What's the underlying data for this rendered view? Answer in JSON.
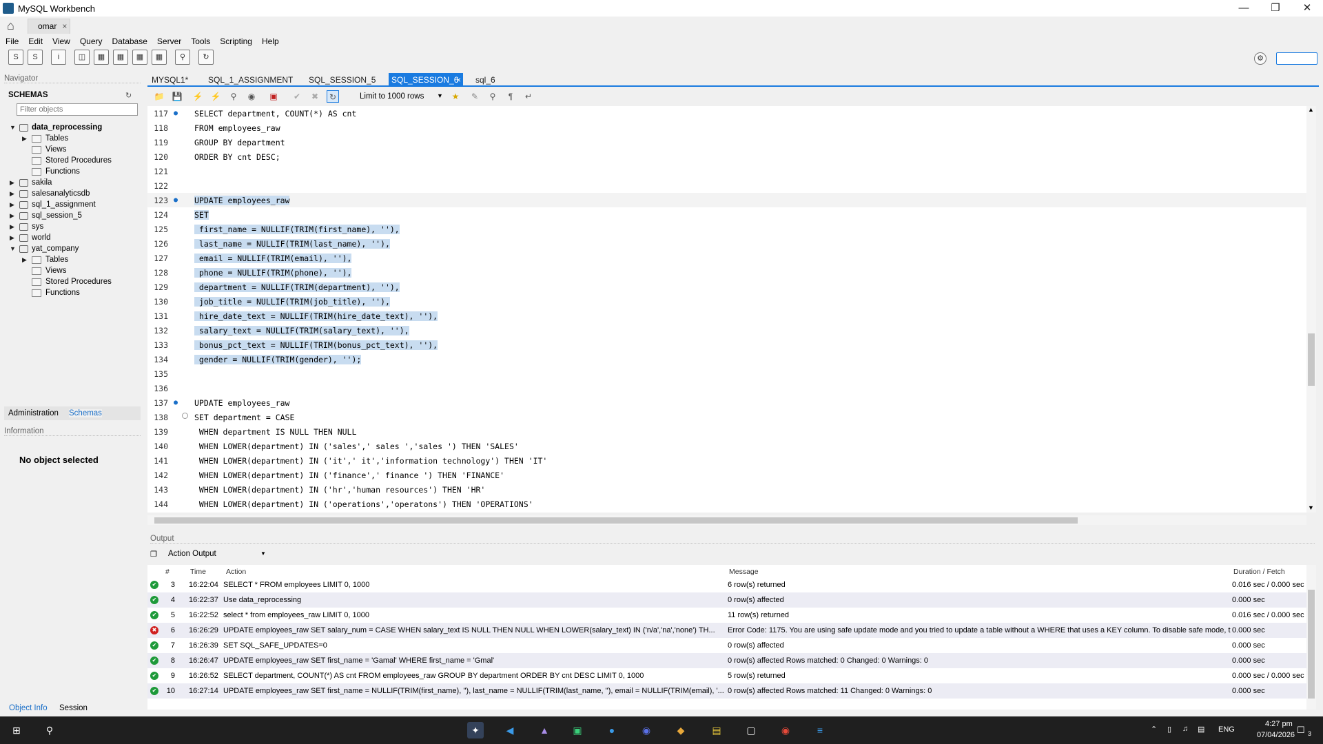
{
  "window": {
    "title": "MySQL Workbench"
  },
  "connection_tab": {
    "label": "omar"
  },
  "menu": [
    "File",
    "Edit",
    "View",
    "Query",
    "Database",
    "Server",
    "Tools",
    "Scripting",
    "Help"
  ],
  "navigator": {
    "header": "Navigator",
    "schemas_label": "SCHEMAS",
    "filter_placeholder": "Filter objects",
    "tree": [
      {
        "label": "data_reprocessing",
        "level": 0,
        "expanded": true,
        "bold": true,
        "type": "db"
      },
      {
        "label": "Tables",
        "level": 1,
        "expanded": false,
        "type": "folder"
      },
      {
        "label": "Views",
        "level": 1,
        "type": "folder"
      },
      {
        "label": "Stored Procedures",
        "level": 1,
        "type": "folder"
      },
      {
        "label": "Functions",
        "level": 1,
        "type": "folder"
      },
      {
        "label": "sakila",
        "level": 0,
        "expanded": false,
        "type": "db"
      },
      {
        "label": "salesanalyticsdb",
        "level": 0,
        "expanded": false,
        "type": "db"
      },
      {
        "label": "sql_1_assignment",
        "level": 0,
        "expanded": false,
        "type": "db"
      },
      {
        "label": "sql_session_5",
        "level": 0,
        "expanded": false,
        "type": "db"
      },
      {
        "label": "sys",
        "level": 0,
        "expanded": false,
        "type": "db"
      },
      {
        "label": "world",
        "level": 0,
        "expanded": false,
        "type": "db"
      },
      {
        "label": "yat_company",
        "level": 0,
        "expanded": true,
        "type": "db"
      },
      {
        "label": "Tables",
        "level": 1,
        "expanded": false,
        "type": "folder"
      },
      {
        "label": "Views",
        "level": 1,
        "type": "folder"
      },
      {
        "label": "Stored Procedures",
        "level": 1,
        "type": "folder"
      },
      {
        "label": "Functions",
        "level": 1,
        "type": "folder"
      }
    ],
    "tab_administration": "Administration",
    "tab_schemas": "Schemas",
    "information_header": "Information",
    "no_object": "No object selected",
    "tab_object_info": "Object Info",
    "tab_session": "Session"
  },
  "editor_tabs": [
    {
      "label": "MYSQL1*",
      "active": false
    },
    {
      "label": "SQL_1_ASSIGNMENT",
      "active": false
    },
    {
      "label": "SQL_SESSION_5",
      "active": false
    },
    {
      "label": "SQL_SESSION_6",
      "active": true
    },
    {
      "label": "sql_6",
      "active": false
    }
  ],
  "editor_toolbar": {
    "limit_label": "Limit to 1000 rows"
  },
  "code_lines": [
    {
      "n": "117",
      "dot": true,
      "hl": false,
      "text": "SELECT department, COUNT(*) AS cnt"
    },
    {
      "n": "118",
      "dot": false,
      "hl": false,
      "text": "FROM employees_raw"
    },
    {
      "n": "119",
      "dot": false,
      "hl": false,
      "text": "GROUP BY department"
    },
    {
      "n": "120",
      "dot": false,
      "hl": false,
      "text": "ORDER BY cnt DESC;"
    },
    {
      "n": "121",
      "dot": false,
      "hl": false,
      "text": ""
    },
    {
      "n": "122",
      "dot": false,
      "hl": false,
      "text": ""
    },
    {
      "n": "123",
      "dot": true,
      "hl": true,
      "text": "UPDATE employees_raw"
    },
    {
      "n": "124",
      "dot": false,
      "hl": true,
      "text": "SET"
    },
    {
      "n": "125",
      "dot": false,
      "hl": true,
      "text": " first_name = NULLIF(TRIM(first_name), ''),"
    },
    {
      "n": "126",
      "dot": false,
      "hl": true,
      "text": " last_name = NULLIF(TRIM(last_name), ''),"
    },
    {
      "n": "127",
      "dot": false,
      "hl": true,
      "text": " email = NULLIF(TRIM(email), ''),"
    },
    {
      "n": "128",
      "dot": false,
      "hl": true,
      "text": " phone = NULLIF(TRIM(phone), ''),"
    },
    {
      "n": "129",
      "dot": false,
      "hl": true,
      "text": " department = NULLIF(TRIM(department), ''),"
    },
    {
      "n": "130",
      "dot": false,
      "hl": true,
      "text": " job_title = NULLIF(TRIM(job_title), ''),"
    },
    {
      "n": "131",
      "dot": false,
      "hl": true,
      "text": " hire_date_text = NULLIF(TRIM(hire_date_text), ''),"
    },
    {
      "n": "132",
      "dot": false,
      "hl": true,
      "text": " salary_text = NULLIF(TRIM(salary_text), ''),"
    },
    {
      "n": "133",
      "dot": false,
      "hl": true,
      "text": " bonus_pct_text = NULLIF(TRIM(bonus_pct_text), ''),"
    },
    {
      "n": "134",
      "dot": false,
      "hl": true,
      "text": " gender = NULLIF(TRIM(gender), '');"
    },
    {
      "n": "135",
      "dot": false,
      "hl": false,
      "text": ""
    },
    {
      "n": "136",
      "dot": false,
      "hl": false,
      "text": ""
    },
    {
      "n": "137",
      "dot": true,
      "hl": false,
      "text": "UPDATE employees_raw"
    },
    {
      "n": "138",
      "dot": false,
      "hl": false,
      "fold": true,
      "text": "SET department = CASE"
    },
    {
      "n": "139",
      "dot": false,
      "hl": false,
      "text": " WHEN department IS NULL THEN NULL"
    },
    {
      "n": "140",
      "dot": false,
      "hl": false,
      "text": " WHEN LOWER(department) IN ('sales',' sales ','sales ') THEN 'SALES'"
    },
    {
      "n": "141",
      "dot": false,
      "hl": false,
      "text": " WHEN LOWER(department) IN ('it',' it','information technology') THEN 'IT'"
    },
    {
      "n": "142",
      "dot": false,
      "hl": false,
      "text": " WHEN LOWER(department) IN ('finance',' finance ') THEN 'FINANCE'"
    },
    {
      "n": "143",
      "dot": false,
      "hl": false,
      "text": " WHEN LOWER(department) IN ('hr','human resources') THEN 'HR'"
    },
    {
      "n": "144",
      "dot": false,
      "hl": false,
      "text": " WHEN LOWER(department) IN ('operations','operatons') THEN 'OPERATIONS'"
    }
  ],
  "output": {
    "header": "Output",
    "selector": "Action Output",
    "columns": {
      "num": "#",
      "time": "Time",
      "action": "Action",
      "message": "Message",
      "duration": "Duration / Fetch"
    },
    "rows": [
      {
        "status": "ok",
        "num": "3",
        "time": "16:22:04",
        "action": "SELECT * FROM employees LIMIT 0, 1000",
        "message": "6 row(s) returned",
        "duration": "0.016 sec / 0.000 sec"
      },
      {
        "status": "ok",
        "num": "4",
        "time": "16:22:37",
        "action": "Use data_reprocessing",
        "message": "0 row(s) affected",
        "duration": "0.000 sec"
      },
      {
        "status": "ok",
        "num": "5",
        "time": "16:22:52",
        "action": "select * from employees_raw LIMIT 0, 1000",
        "message": "11 row(s) returned",
        "duration": "0.016 sec / 0.000 sec"
      },
      {
        "status": "err",
        "num": "6",
        "time": "16:26:29",
        "action": "UPDATE employees_raw SET salary_num = CASE     WHEN salary_text IS NULL THEN NULL     WHEN LOWER(salary_text) IN ('n/a','na','none') TH...",
        "message": "Error Code: 1175. You are using safe update mode and you tried to update a table without a WHERE that uses a KEY column.  To disable safe mode, t...",
        "duration": "0.000 sec"
      },
      {
        "status": "ok",
        "num": "7",
        "time": "16:26:39",
        "action": "SET SQL_SAFE_UPDATES=0",
        "message": "0 row(s) affected",
        "duration": "0.000 sec"
      },
      {
        "status": "ok",
        "num": "8",
        "time": "16:26:47",
        "action": "UPDATE employees_raw SET first_name = 'Gamal' WHERE first_name = 'Gmal'",
        "message": "0 row(s) affected Rows matched: 0  Changed: 0  Warnings: 0",
        "duration": "0.000 sec"
      },
      {
        "status": "ok",
        "num": "9",
        "time": "16:26:52",
        "action": "SELECT department, COUNT(*) AS cnt FROM employees_raw GROUP BY department ORDER BY cnt DESC LIMIT 0, 1000",
        "message": "5 row(s) returned",
        "duration": "0.000 sec / 0.000 sec"
      },
      {
        "status": "ok",
        "num": "10",
        "time": "16:27:14",
        "action": "UPDATE employees_raw SET  first_name = NULLIF(TRIM(first_name), ''),  last_name = NULLIF(TRIM(last_name, ''),  email = NULLIF(TRIM(email), '...",
        "message": "0 row(s) affected Rows matched: 11  Changed: 0  Warnings: 0",
        "duration": "0.000 sec"
      }
    ]
  },
  "taskbar": {
    "language": "ENG",
    "time": "4:27 pm",
    "date": "07/04/2026",
    "notification_count": "3"
  }
}
